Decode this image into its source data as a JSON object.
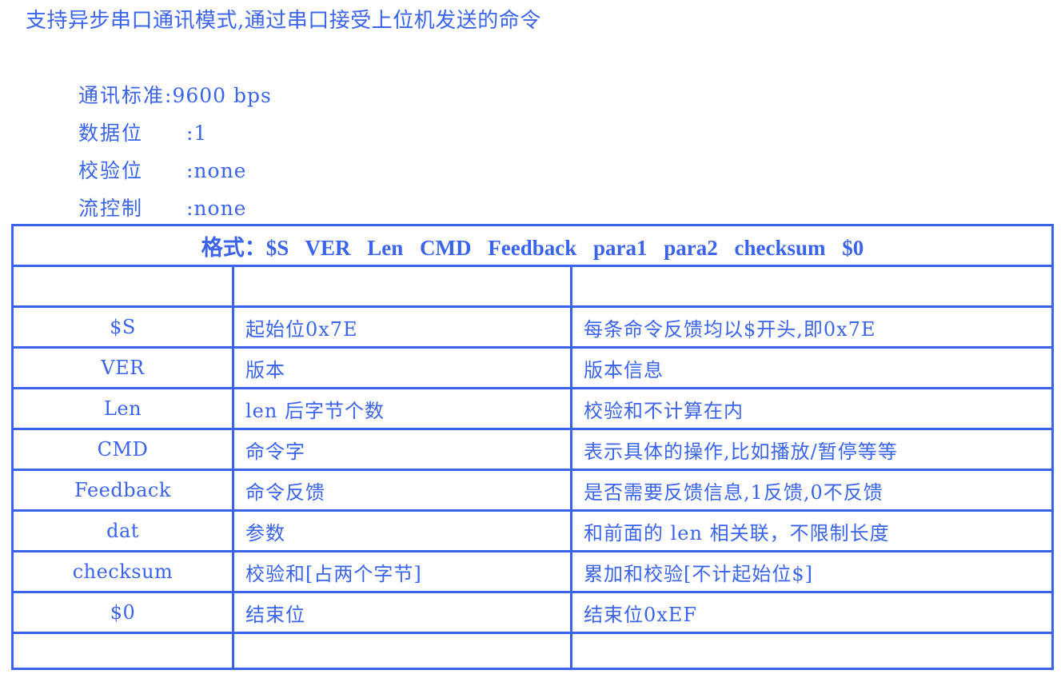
{
  "intro": "支持异步串口通讯模式,通过串口接受上位机发送的命令",
  "settings": [
    {
      "label": "通讯标准",
      "value": ":9600 bps"
    },
    {
      "label": "数据位",
      "value": ":1"
    },
    {
      "label": "校验位",
      "value": ":none"
    },
    {
      "label": "流控制",
      "value": ":none"
    }
  ],
  "table": {
    "format": "格式：$S VER Len CMD Feedback para1 para2 checksum $0",
    "rows": [
      {
        "field": "",
        "meaning": "",
        "note": ""
      },
      {
        "field": "$S",
        "meaning": "起始位0x7E",
        "note": "每条命令反馈均以$开头,即0x7E"
      },
      {
        "field": "VER",
        "meaning": "版本",
        "note": "版本信息"
      },
      {
        "field": "Len",
        "meaning": "len 后字节个数",
        "note": "校验和不计算在内"
      },
      {
        "field": "CMD",
        "meaning": "命令字",
        "note": "表示具体的操作,比如播放/暂停等等"
      },
      {
        "field": "Feedback",
        "meaning": "命令反馈",
        "note": "是否需要反馈信息,1反馈,0不反馈"
      },
      {
        "field": "dat",
        "meaning": "参数",
        "note": "和前面的 len 相关联，不限制长度"
      },
      {
        "field": "checksum",
        "meaning": "校验和[占两个字节]",
        "note": "累加和校验[不计起始位$]"
      },
      {
        "field": "$0",
        "meaning": "结束位",
        "note": "结束位0xEF"
      },
      {
        "field": "",
        "meaning": "",
        "note": ""
      }
    ]
  },
  "colors": {
    "text": "#3a64ee",
    "border": "#3a64ee",
    "background": "#ffffff"
  }
}
